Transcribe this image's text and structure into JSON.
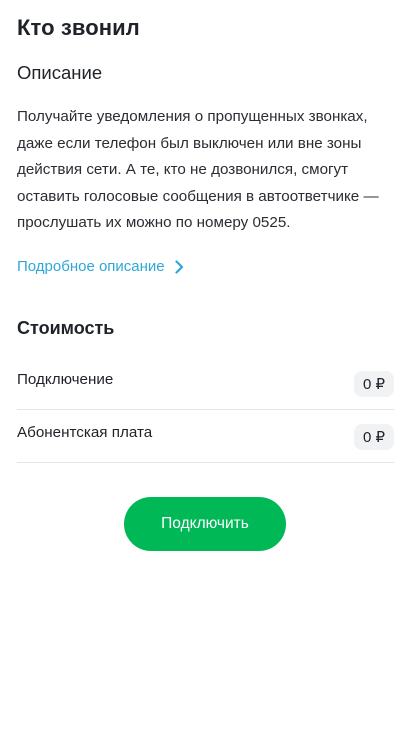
{
  "page": {
    "title": "Кто звонил"
  },
  "description": {
    "heading": "Описание",
    "text": "Получайте уведомления о пропущенных звонках, даже если телефон был выключен или вне зоны действия сети. А те, кто не дозвонился, смогут оставить голосовые сообщения в автоответчике — прослушать их можно по номеру 0525.",
    "more_link": "Подробное описание",
    "link_color": "#2fa7d6"
  },
  "cost": {
    "heading": "Стоимость",
    "rows": [
      {
        "label": "Подключение",
        "price": "0 ₽"
      },
      {
        "label": "Абонентская плата",
        "price": "0 ₽"
      }
    ]
  },
  "actions": {
    "connect_label": "Подключить",
    "accent_color": "#00b956"
  },
  "icons": {
    "more_link_icon": "chevron-right-icon"
  }
}
